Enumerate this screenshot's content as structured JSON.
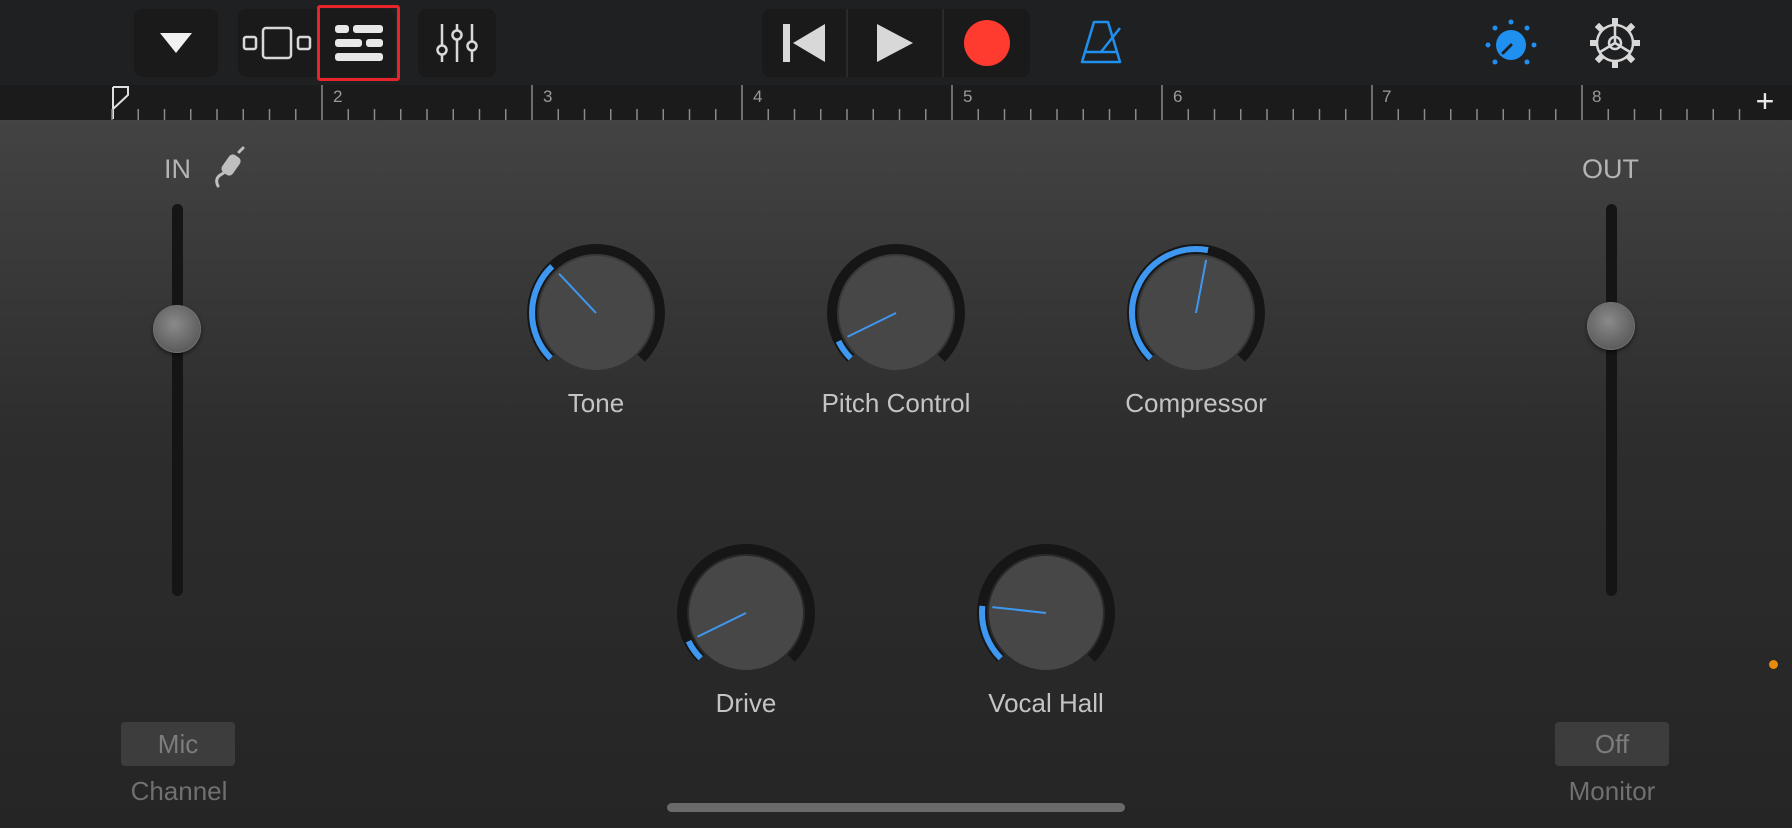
{
  "toolbar": {
    "dropdown_icon": "triangle-down-icon",
    "tracks_view_icon": "tracks-view-icon",
    "instrument_view_icon": "controls-view-icon",
    "mixer_icon": "sliders-icon",
    "rewind_icon": "skip-back-icon",
    "play_icon": "play-icon",
    "record_icon": "record-icon",
    "metronome_icon": "metronome-icon",
    "master_volume_icon": "volume-knob-icon",
    "settings_icon": "gear-icon",
    "accent_color": "#1f8ff0",
    "record_color": "#ff3b30"
  },
  "ruler": {
    "bars": [
      "2",
      "3",
      "4",
      "5",
      "6",
      "7",
      "8"
    ],
    "add_icon": "+"
  },
  "input": {
    "label": "IN",
    "jack_icon": "input-jack-icon",
    "level": 0.32,
    "channel_button": "Mic",
    "channel_caption": "Channel"
  },
  "output": {
    "label": "OUT",
    "level": 0.31,
    "monitor_button": "Off",
    "monitor_caption": "Monitor"
  },
  "knobs": [
    {
      "name": "Tone",
      "value": 0.34
    },
    {
      "name": "Pitch Control",
      "value": 0.07
    },
    {
      "name": "Compressor",
      "value": 0.54
    },
    {
      "name": "Drive",
      "value": 0.07
    },
    {
      "name": "Vocal Hall",
      "value": 0.19
    }
  ]
}
